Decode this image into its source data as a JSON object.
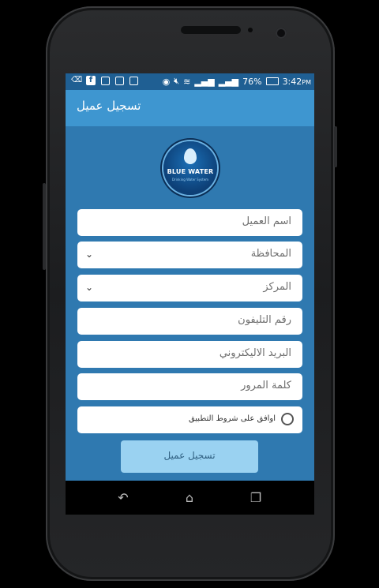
{
  "statusbar": {
    "left_icons": [
      "usb-icon",
      "facebook-icon",
      "checkbox-icon",
      "code-icon",
      "code-icon"
    ],
    "right_icons": [
      "cast-icon",
      "mute-icon",
      "wifi-icon",
      "signal-1-icon",
      "signal-2-icon"
    ],
    "battery": "76%",
    "time": "3:42",
    "ampm": "PM"
  },
  "appbar": {
    "title": "تسجيل عميل"
  },
  "logo": {
    "name": "BLUE WATER",
    "sub": "Drinking Water System"
  },
  "form": {
    "customer_name": "اسم العميل",
    "governorate": "المحافظة",
    "center": "المركز",
    "phone": "رقم التليفون",
    "email": "البريد الاليكتروني",
    "password": "كلمة المرور",
    "terms": "اوافق على شروط التطبيق"
  },
  "submit": {
    "label": "تسجيل عميل"
  },
  "nav": {
    "back_icon": "back-icon",
    "home_icon": "home-icon",
    "recents_icon": "recents-icon"
  },
  "colors": {
    "screen_bg": "#2f79b0",
    "appbar": "#3e96d0",
    "statusbar": "#1f5f93",
    "button": "#9ad2f1"
  }
}
